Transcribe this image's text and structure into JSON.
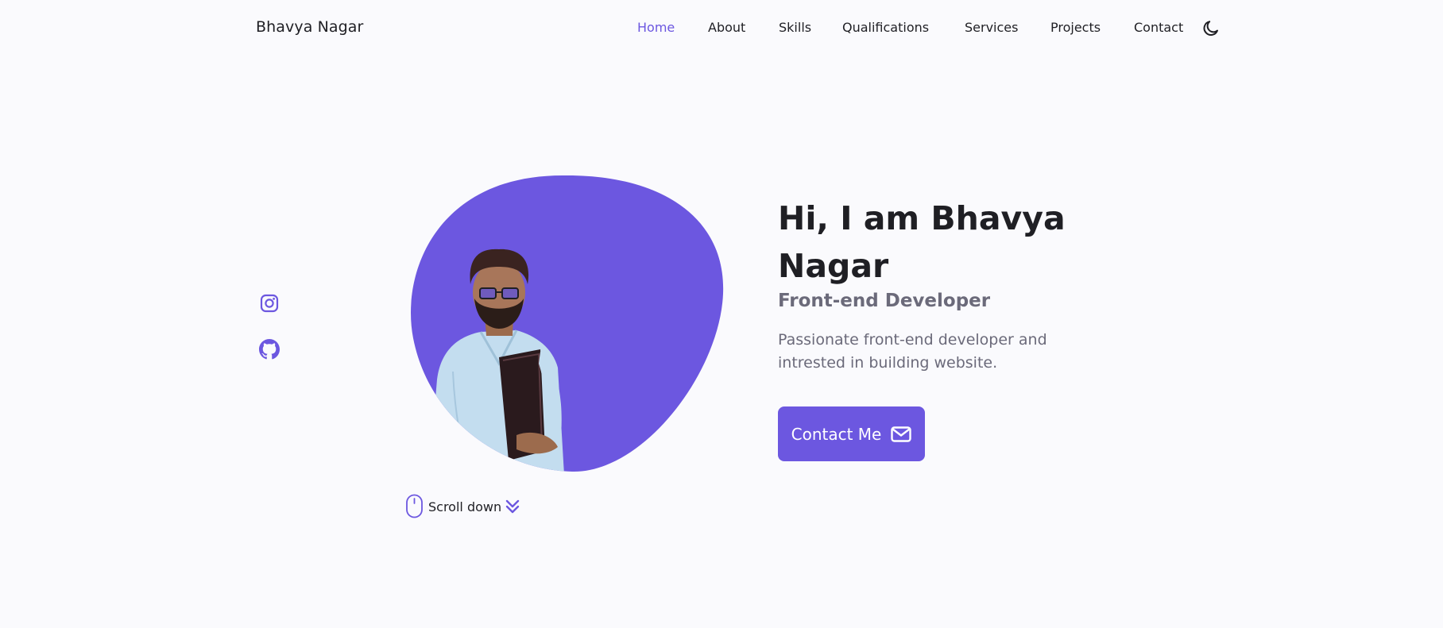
{
  "header": {
    "logo": "Bhavya Nagar",
    "nav": [
      "Home",
      "About",
      "Skills",
      "Qualifications",
      "Services",
      "Projects",
      "Contact"
    ],
    "active_nav": "Home",
    "theme_toggle_icon": "moon-icon"
  },
  "social": {
    "icons": [
      "instagram-icon",
      "github-icon"
    ]
  },
  "hero": {
    "title": "Hi, I am Bhavya Nagar",
    "subtitle": "Front-end Developer",
    "description": "Passionate front-end developer and intrested in building website.",
    "button_label": "Contact Me",
    "button_icon": "mail-icon",
    "scroll_label": "Scroll down",
    "scroll_icons": [
      "mouse-icon",
      "double-chevron-down-icon"
    ]
  },
  "colors": {
    "accent": "#6c57e0",
    "background": "#fafafd",
    "text": "#1f1f24",
    "muted_text": "#6b6a7a"
  }
}
